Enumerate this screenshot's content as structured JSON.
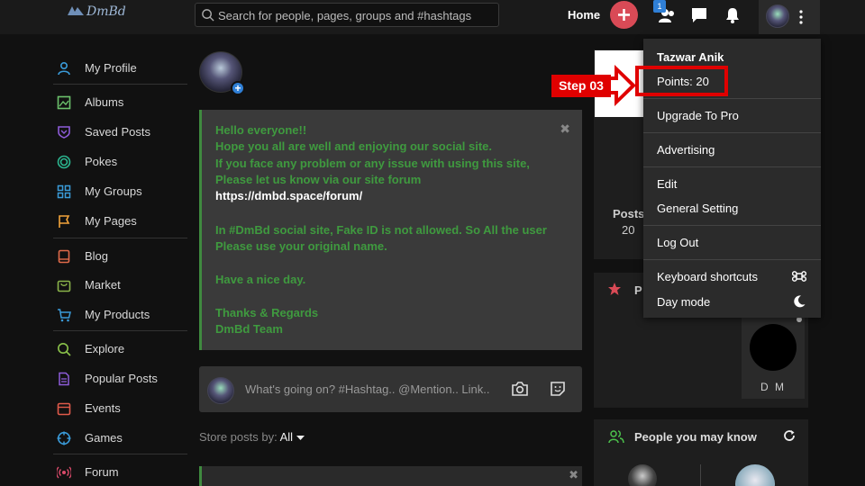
{
  "header": {
    "logo_text": "DmBd",
    "search_placeholder": "Search for people, pages, groups and #hashtags",
    "home_label": "Home",
    "notification_count": "1"
  },
  "sidebar": {
    "items": [
      {
        "label": "My Profile",
        "icon": "user-icon",
        "color": "#3a9bd9"
      },
      {
        "label": "Albums",
        "icon": "image-icon",
        "color": "#6cc26c"
      },
      {
        "label": "Saved Posts",
        "icon": "bookmark-icon",
        "color": "#8e5cd9"
      },
      {
        "label": "Pokes",
        "icon": "target-icon",
        "color": "#2bb58f"
      },
      {
        "label": "My Groups",
        "icon": "grid-icon",
        "color": "#3a9bd9"
      },
      {
        "label": "My Pages",
        "icon": "flag-icon",
        "color": "#f2a33a"
      },
      {
        "label": "Blog",
        "icon": "book-icon",
        "color": "#e06a4a"
      },
      {
        "label": "Market",
        "icon": "bag-icon",
        "color": "#8ab34a"
      },
      {
        "label": "My Products",
        "icon": "cart-icon",
        "color": "#3a9bd9"
      },
      {
        "label": "Explore",
        "icon": "search-icon",
        "color": "#8ac24a"
      },
      {
        "label": "Popular Posts",
        "icon": "document-icon",
        "color": "#8e5cd9"
      },
      {
        "label": "Events",
        "icon": "calendar-icon",
        "color": "#e05a4a"
      },
      {
        "label": "Games",
        "icon": "crosshair-icon",
        "color": "#3a9bd9"
      },
      {
        "label": "Forum",
        "icon": "broadcast-icon",
        "color": "#d94a6a"
      }
    ]
  },
  "announcement": {
    "lines": [
      "Hello everyone!!",
      "Hope you all are well and enjoying our social site.",
      "If you face any problem or any issue with using this site,",
      "Please let us know via our site forum",
      "https://dmbd.space/forum/",
      "In #DmBd social site, Fake ID is not allowed. So All the user",
      "Please use your original name.",
      "Have a nice day.",
      "Thanks & Regards",
      "DmBd Team"
    ],
    "close_glyph": "✖"
  },
  "composer": {
    "placeholder": "What's going on? #Hashtag.. @Mention.. Link.."
  },
  "feed": {
    "store_posts_label": "Store posts by:",
    "store_posts_value": "All"
  },
  "right": {
    "posts_label": "Posts",
    "posts_value": "20",
    "pro_card_title_fragment": "P",
    "dm_name": "D M",
    "people_title": "People you may know"
  },
  "dropdown": {
    "user_name": "Tazwar Anik",
    "points": "Points: 20",
    "upgrade": "Upgrade To Pro",
    "advertising": "Advertising",
    "edit": "Edit",
    "general_setting": "General Setting",
    "logout": "Log Out",
    "keyboard_shortcuts": "Keyboard shortcuts",
    "day_mode": "Day mode"
  },
  "annotation": {
    "step_label": "Step 03",
    "highlight_color": "#e00000"
  }
}
